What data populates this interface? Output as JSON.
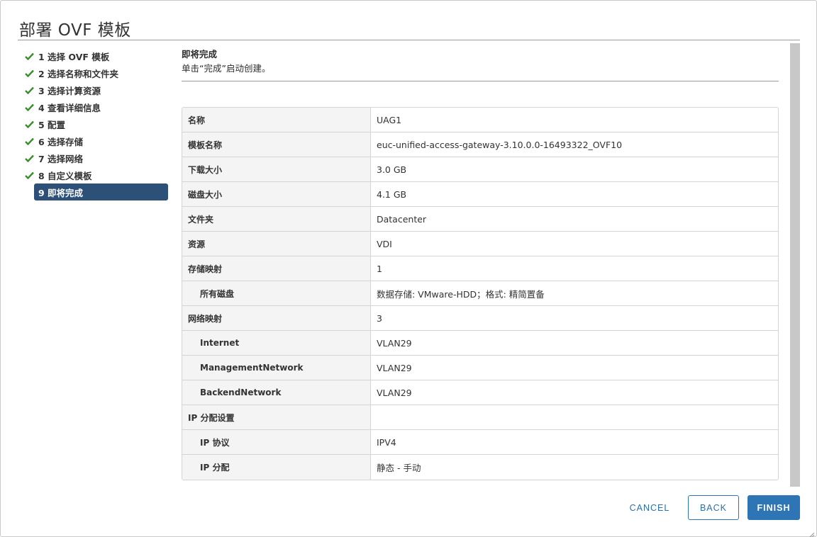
{
  "dialog": {
    "title": "部署 OVF 模板"
  },
  "steps": [
    {
      "label": "1 选择 OVF 模板",
      "done": true
    },
    {
      "label": "2 选择名称和文件夹",
      "done": true
    },
    {
      "label": "3 选择计算资源",
      "done": true
    },
    {
      "label": "4 查看详细信息",
      "done": true
    },
    {
      "label": "5 配置",
      "done": true
    },
    {
      "label": "6 选择存储",
      "done": true
    },
    {
      "label": "7 选择网络",
      "done": true
    },
    {
      "label": "8 自定义模板",
      "done": true
    },
    {
      "label": "9 即将完成",
      "active": true
    }
  ],
  "content": {
    "title": "即将完成",
    "subtitle": "单击“完成”启动创建。"
  },
  "summary": [
    {
      "key": "名称",
      "value": "UAG1",
      "indent": false
    },
    {
      "key": "模板名称",
      "value": "euc-unified-access-gateway-3.10.0.0-16493322_OVF10",
      "indent": false
    },
    {
      "key": "下载大小",
      "value": "3.0 GB",
      "indent": false
    },
    {
      "key": "磁盘大小",
      "value": "4.1 GB",
      "indent": false
    },
    {
      "key": "文件夹",
      "value": "Datacenter",
      "indent": false
    },
    {
      "key": "资源",
      "value": "VDI",
      "indent": false
    },
    {
      "key": "存储映射",
      "value": "1",
      "indent": false
    },
    {
      "key": "所有磁盘",
      "value": "数据存储: VMware-HDD；格式: 精简置备",
      "indent": true
    },
    {
      "key": "网络映射",
      "value": "3",
      "indent": false
    },
    {
      "key": "Internet",
      "value": "VLAN29",
      "indent": true
    },
    {
      "key": "ManagementNetwork",
      "value": "VLAN29",
      "indent": true
    },
    {
      "key": "BackendNetwork",
      "value": "VLAN29",
      "indent": true
    },
    {
      "key": "IP 分配设置",
      "value": "",
      "indent": false
    },
    {
      "key": "IP 协议",
      "value": "IPV4",
      "indent": true
    },
    {
      "key": "IP 分配",
      "value": "静态 - 手动",
      "indent": true
    }
  ],
  "footer": {
    "cancel_label": "CANCEL",
    "back_label": "BACK",
    "finish_label": "FINISH"
  },
  "colors": {
    "accent": "#2e75b6",
    "active_step": "#2d5079",
    "check": "#3c8d2f"
  }
}
